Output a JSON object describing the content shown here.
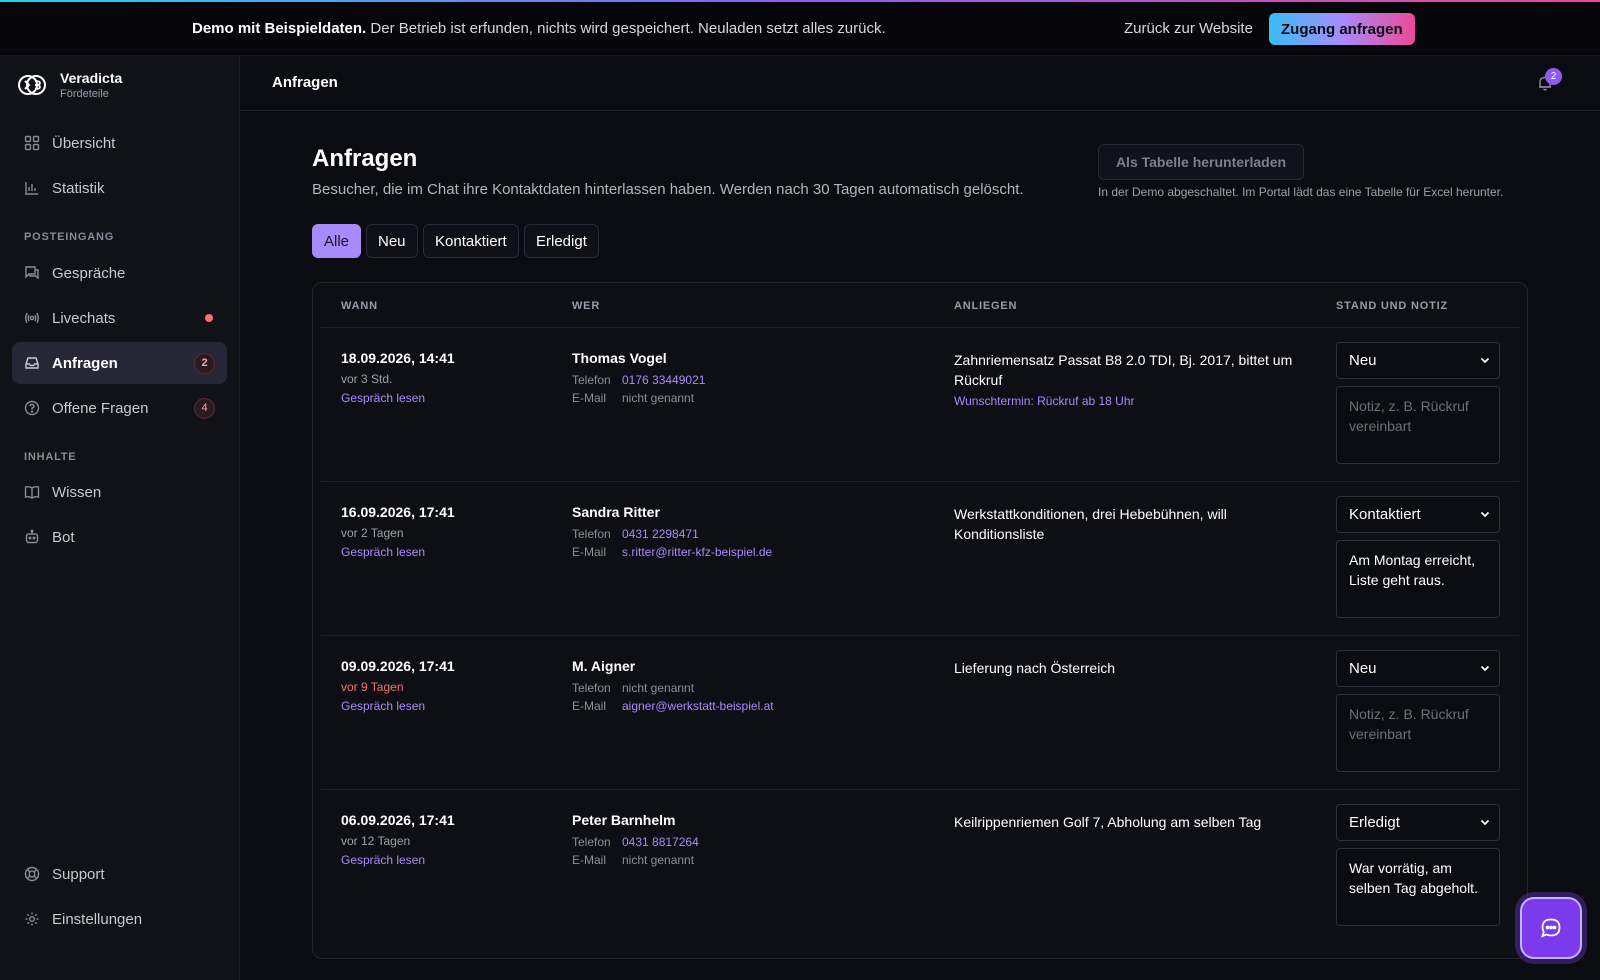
{
  "banner": {
    "bold": "Demo mit Beispieldaten.",
    "text": "Der Betrieb ist erfunden, nichts wird gespeichert. Neuladen setzt alles zurück.",
    "back_link": "Zurück zur Website",
    "access_button": "Zugang anfragen"
  },
  "brand": {
    "name": "Veradicta",
    "sub": "Fördeteile"
  },
  "sidebar": {
    "items": [
      {
        "label": "Übersicht",
        "icon": "grid-icon"
      },
      {
        "label": "Statistik",
        "icon": "bar-chart-icon"
      }
    ],
    "section_inbox": "POSTEINGANG",
    "inbox": [
      {
        "label": "Gespräche",
        "icon": "chat-bubbles-icon"
      },
      {
        "label": "Livechats",
        "icon": "broadcast-icon",
        "dot": true
      },
      {
        "label": "Anfragen",
        "icon": "inbox-icon",
        "badge": "2",
        "active": true
      },
      {
        "label": "Offene Fragen",
        "icon": "question-icon",
        "badge": "4"
      }
    ],
    "section_content": "INHALTE",
    "content": [
      {
        "label": "Wissen",
        "icon": "book-icon"
      },
      {
        "label": "Bot",
        "icon": "robot-icon"
      }
    ],
    "bottom": [
      {
        "label": "Support",
        "icon": "lifebuoy-icon"
      },
      {
        "label": "Einstellungen",
        "icon": "gear-icon"
      }
    ]
  },
  "header": {
    "title": "Anfragen",
    "notifications": "2"
  },
  "main": {
    "title": "Anfragen",
    "subtitle": "Besucher, die im Chat ihre Kontaktdaten hinterlassen haben. Werden nach 30 Tagen automatisch gelöscht.",
    "export_button": "Als Tabelle herunterladen",
    "export_note": "In der Demo abgeschaltet. Im Portal lädt das eine Tabelle für Excel herunter.",
    "filters": [
      "Alle",
      "Neu",
      "Kontaktiert",
      "Erledigt"
    ],
    "active_filter": "Alle"
  },
  "table": {
    "headers": [
      "WANN",
      "WER",
      "ANLIEGEN",
      "STAND UND NOTIZ"
    ],
    "phone_label": "Telefon",
    "email_label": "E-Mail",
    "read_link": "Gespräch lesen",
    "note_placeholder": "Notiz, z. B. Rückruf vereinbart",
    "rows": [
      {
        "when": "18.09.2026, 14:41",
        "ago": "vor 3 Std.",
        "name": "Thomas Vogel",
        "phone": "0176 33449021",
        "email": "nicht genannt",
        "concern": "Zahnriemensatz Passat B8 2.0 TDI, Bj. 2017, bittet um Rückruf",
        "wish": "Wunschtermin: Rückruf ab 18 Uhr",
        "status": "Neu",
        "note": ""
      },
      {
        "when": "16.09.2026, 17:41",
        "ago": "vor 2 Tagen",
        "name": "Sandra Ritter",
        "phone": "0431 2298471",
        "email": "s.ritter@ritter-kfz-beispiel.de",
        "concern": "Werkstattkonditionen, drei Hebebühnen, will Konditionsliste",
        "wish": "",
        "status": "Kontaktiert",
        "note": "Am Montag erreicht, Liste geht raus."
      },
      {
        "when": "09.09.2026, 17:41",
        "ago": "vor 9 Tagen",
        "name": "M. Aigner",
        "phone": "nicht genannt",
        "email": "aigner@werkstatt-beispiel.at",
        "concern": "Lieferung nach Österreich",
        "wish": "",
        "status": "Neu",
        "note": ""
      },
      {
        "when": "06.09.2026, 17:41",
        "ago": "vor 12 Tagen",
        "name": "Peter Barnhelm",
        "phone": "0431 8817264",
        "email": "nicht genannt",
        "concern": "Keilrippenriemen Golf 7, Abholung am selben Tag",
        "wish": "",
        "status": "Erledigt",
        "note": "War vorrätig, am selben Tag abgeholt."
      }
    ]
  },
  "colors": {
    "accent": "#a78bfa",
    "warn": "#f87171",
    "background": "#0b0b12"
  }
}
